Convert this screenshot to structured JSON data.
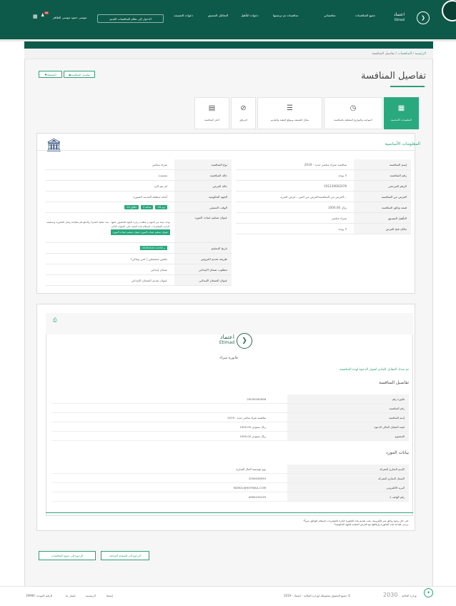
{
  "header": {
    "logo_ar": "اعتماد",
    "logo_en": "Etimad",
    "nav": [
      "جميع المنافسات",
      "منافساتي",
      "منافسات تم ترسيتها",
      "دعوات التأهيل",
      "التحاليل المسبق",
      "دعوات التصنيف"
    ],
    "old_system": "الدخول إلى نظام المنافسات القديم",
    "user": "موسى حمود موسى الظافر",
    "badge": "18"
  },
  "breadcrumb": {
    "home": "الرئيسية",
    "sep": "/",
    "tenders": "المنافسات",
    "current": "تفاصيل المنافسة"
  },
  "page_title": "تفاصيل المنافسة",
  "top_buttons": {
    "details": "تفاصيل المنافسة",
    "favorite": "المفضلة"
  },
  "tabs": [
    {
      "label": "المعلومات الأساسية",
      "icon": "▦"
    },
    {
      "label": "المواعيد والتواريخ المتعلقة بالمنافسة",
      "icon": "◷"
    },
    {
      "label": "مجال التصنيف وموقع التنفيذ والتقديم",
      "icon": "☰"
    },
    {
      "label": "المرفق",
      "icon": "⊘"
    },
    {
      "label": "أخبار المنافسة",
      "icon": "▤"
    }
  ],
  "basic": {
    "title": "المعلومات الأساسية",
    "right_rows": [
      {
        "k": "إسم المنافسة",
        "v": "منافسة شراء مباشر جديد - 2019"
      },
      {
        "k": "رقم المنافسة",
        "v": "لا يوجد"
      },
      {
        "k": "الرقم المرجعي",
        "v": "191239002078"
      },
      {
        "k": "الغرض من المنافسة",
        "v": "الغرض من المنافسةالغرض من المن...عرض المزيد..."
      },
      {
        "k": "قيمة وثائق المنافسة",
        "v": "1000.00 ريال"
      },
      {
        "k": "التأهيل المسبق",
        "v": "شراء مباشر"
      },
      {
        "k": "مكان فتح العرض",
        "v": "لا يوجد"
      }
    ],
    "left_rows": [
      {
        "k": "نوع المنافسة",
        "v": "شراء مباشر"
      },
      {
        "k": "حالة المنافسة",
        "v": "معتمدة"
      },
      {
        "k": "حالة العرض",
        "v": "لم يتم الرد"
      },
      {
        "k": "الجهة الحكومية",
        "v": "أمانة منطقة المدينة المنورة"
      },
      {
        "k": "الوقت المتبقي",
        "v": ""
      },
      {
        "k": "عنوان تسليم عينات المورد",
        "v": "يوجد عينة من الجهة و يتطلب زيارة الجهة للحصول عليها . بعد عملية الشراء والدفع قم بطباعة وصل الفاتورة وتسليمه لإدارة المشتريات لإستلام هذه العينة على العنوان التالي:"
      },
      {
        "k": "تاريخ التسليم",
        "v": ""
      },
      {
        "k": "طريقة تقديم العروض",
        "v": "ملفين منفصلين ( فني ومالي)"
      },
      {
        "k": "مطلوب ضمان الإبتدائي",
        "v": "ضمان إبتدائي"
      },
      {
        "k": "عنوان الضمان الإبتدائي",
        "v": "عنوان تقديم الضمان الإبتدائي"
      }
    ],
    "remaining": {
      "days": "16 يوم",
      "hours": "2 ساعة",
      "minutes": "24 دقائق"
    },
    "samples_addr": "عنوان تسليم عينات المورد عنوان تسليم عينات المورد",
    "delivery_date": "2019/4/14 12:00 م"
  },
  "invoice": {
    "logo_ar": "اعتماد",
    "logo_en": "Etimad",
    "title": "فاتورة شراء",
    "paid_msg": "تم سداد المقابل المادي لقبول الدعوة لهذه المنافسة",
    "tender_h": "تفاصيل المنافسة",
    "tender_rows": [
      {
        "k": "فاتورة رقم",
        "v": "20030160098"
      },
      {
        "k": "رقم المنافسة",
        "v": ""
      },
      {
        "k": "إسم المنافسة",
        "v": "منافسة شراء مباشر جديد - 2019"
      },
      {
        "k": "قيمة المقابل المالي الدعوة",
        "v": "1000.00 ريال سعودي"
      },
      {
        "k": "المجموع",
        "v": "1000.00 ريال سعودي"
      }
    ],
    "supplier_h": "بيانات المورد",
    "supplier_rows": [
      {
        "k": "الإسم التجاري للشركة",
        "v": "نوع مؤسسة المال التجارية"
      },
      {
        "k": "السجل التجاري للشركة",
        "v": "2050038594"
      },
      {
        "k": "البريد الالكتروني",
        "v": "MZM21@HOTMAIL.COM"
      },
      {
        "k": "رقم الهاتف 1",
        "v": "0565109139"
      }
    ],
    "note1": "*في حال وجود وثائق غير إلكترونية، يجب تقديم هذه الفاتورة لإدارة المشتريات لإستلام الوثائق يدوياً.",
    "note2": "*يرجى طباعة هذه الفاتورة وإرفاقها مع العرض المقدم للجهة الحكومية."
  },
  "footer_buttons": {
    "back_page": "الرجوع إلى الصفحة السابقة",
    "back_all": "الرجوع إلى جميع المنافسات"
  },
  "footer": {
    "copyright": "جميع الحقوق محفوظة لوزارة المالية - اعتماد - 2019 ©",
    "vision": "2030",
    "ministry": "وزارة المالية",
    "links": [
      "إعتماد",
      "الرئيسية",
      "إتصل بنا",
      "الرقم الموحد: 19990"
    ]
  }
}
